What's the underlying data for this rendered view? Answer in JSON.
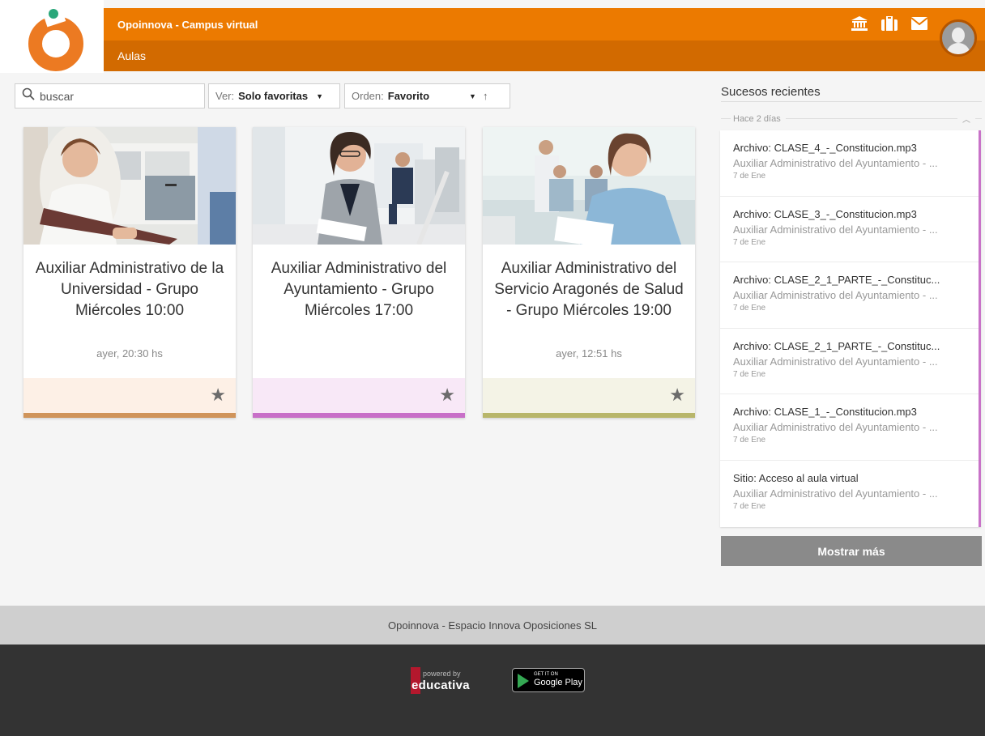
{
  "header": {
    "site_title": "Opoinnova - Campus virtual",
    "section": "Aulas",
    "brand_color": "#ec7a00",
    "icons": [
      "institution-icon",
      "briefcase-icon",
      "envelope-icon"
    ]
  },
  "filters": {
    "search_placeholder": "buscar",
    "ver_label": "Ver:",
    "ver_value": "Solo favoritas",
    "orden_label": "Orden:",
    "orden_value": "Favorito"
  },
  "courses": [
    {
      "title": "Auxiliar Administrativo de la Universidad - Grupo Miércoles 10:00",
      "last_access": "ayer, 20:30 hs",
      "footer_color": "#fdf0e6",
      "bar_color": "#d0945a"
    },
    {
      "title": "Auxiliar Administrativo del Ayuntamiento - Grupo Miércoles 17:00",
      "last_access": "",
      "footer_color": "#f8e8f7",
      "bar_color": "#c86fc8"
    },
    {
      "title": "Auxiliar Administrativo del Servicio Aragonés de Salud - Grupo Miércoles 19:00",
      "last_access": "ayer, 12:51 hs",
      "footer_color": "#f4f3e6",
      "bar_color": "#b8b66a"
    }
  ],
  "recent": {
    "title": "Sucesos recientes",
    "group_label": "Hace 2 días",
    "items": [
      {
        "title": "Archivo: CLASE_4_-_Constitucion.mp3",
        "course": "Auxiliar Administrativo del Ayuntamiento - ...",
        "date": "7 de Ene"
      },
      {
        "title": "Archivo: CLASE_3_-_Constitucion.mp3",
        "course": "Auxiliar Administrativo del Ayuntamiento - ...",
        "date": "7 de Ene"
      },
      {
        "title": "Archivo: CLASE_2_1_PARTE_-_Constituc...",
        "course": "Auxiliar Administrativo del Ayuntamiento - ...",
        "date": "7 de Ene"
      },
      {
        "title": "Archivo: CLASE_2_1_PARTE_-_Constituc...",
        "course": "Auxiliar Administrativo del Ayuntamiento - ...",
        "date": "7 de Ene"
      },
      {
        "title": "Archivo: CLASE_1_-_Constitucion.mp3",
        "course": "Auxiliar Administrativo del Ayuntamiento - ...",
        "date": "7 de Ene"
      },
      {
        "title": "Sitio: Acceso al aula virtual",
        "course": "Auxiliar Administrativo del Ayuntamiento - ...",
        "date": "7 de Ene"
      }
    ],
    "more_label": "Mostrar más"
  },
  "footer": {
    "company": "Opoinnova - Espacio Innova Oposiciones SL",
    "powered_by": "powered by",
    "educativa": "educativa",
    "gplay_small": "GET IT ON",
    "gplay_big": "Google Play"
  }
}
